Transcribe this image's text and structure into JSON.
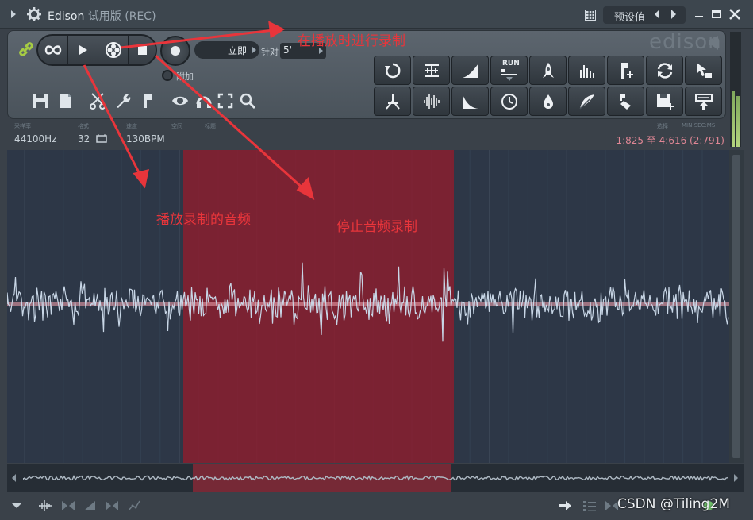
{
  "window": {
    "app_name": "Edison",
    "mode": "试用版 (REC)",
    "preset_label": "预设值",
    "icons": [
      "menu-arrow-icon",
      "gear-icon",
      "grid-icon",
      "prev-icon",
      "next-icon",
      "minimize-icon",
      "maximize-icon",
      "close-icon"
    ]
  },
  "toolbar": {
    "logo_text": "edison",
    "record_mode": "立即",
    "threshold_label": "针对",
    "threshold_value": "5'",
    "append_label": "附加",
    "transport_icons": [
      "loop-icon",
      "play-icon",
      "record-mode-icon",
      "stop-icon",
      "record-icon"
    ],
    "small_icons": [
      "save-icon",
      "new-icon",
      "cut-icon",
      "wrench-icon",
      "marker-icon",
      "eye-icon",
      "headphones-icon",
      "fit-icon",
      "zoom-icon"
    ],
    "tool_buttons": [
      {
        "name": "undo-tool",
        "label": ""
      },
      {
        "name": "normalize-tool",
        "label": ""
      },
      {
        "name": "fade-in-tool",
        "label": ""
      },
      {
        "name": "run-script-tool",
        "label": "RUN"
      },
      {
        "name": "denoise-tool",
        "label": ""
      },
      {
        "name": "equalizer-tool",
        "label": ""
      },
      {
        "name": "add-marker-tool",
        "label": ""
      },
      {
        "name": "loop-tool",
        "label": ""
      },
      {
        "name": "send-to-playlist-tool",
        "label": ""
      },
      {
        "name": "trim-tool",
        "label": ""
      },
      {
        "name": "spectral-tool",
        "label": ""
      },
      {
        "name": "fade-out-tool",
        "label": ""
      },
      {
        "name": "time-stretch-tool",
        "label": ""
      },
      {
        "name": "dc-offset-tool",
        "label": ""
      },
      {
        "name": "feather-tool",
        "label": ""
      },
      {
        "name": "slice-tool",
        "label": ""
      },
      {
        "name": "save-selection-tool",
        "label": ""
      },
      {
        "name": "export-tool",
        "label": ""
      }
    ]
  },
  "info": {
    "sample_rate_key": "采样率",
    "sample_rate": "44100Hz",
    "format_key": "格式",
    "format": "32",
    "tempo_key": "速度",
    "tempo": "130BPM",
    "space_key": "空间",
    "title_key": "标题",
    "selection_key": "选择",
    "unit_key": "MIN:SEC:MS",
    "selection_value": "1:825 至 4:616 (2:791)"
  },
  "annotations": {
    "record_while_playing": "在播放时进行录制",
    "play_recorded": "播放录制的音频",
    "stop_recording": "停止音频录制"
  },
  "watermark": "CSDN @Tiling2M",
  "colors": {
    "waveform": "#c8d6e6",
    "selection": "#8a1f2f",
    "annotation": "#e8353b",
    "accent_green": "#a6cc44"
  }
}
